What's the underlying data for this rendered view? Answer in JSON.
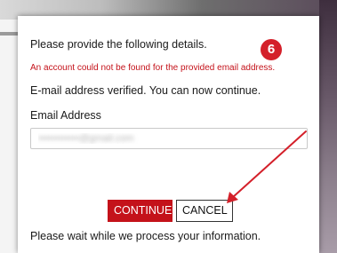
{
  "dialog": {
    "prompt": "Please provide the following details.",
    "error_message": "An account could not be found for the provided email address.",
    "verified_message": "E-mail address verified. You can now continue.",
    "email_label": "Email Address",
    "email_value": "••••••••••••@gmail.com",
    "continue_label": "CONTINUE",
    "cancel_label": "CANCEL",
    "wait_message": "Please wait while we process your information."
  },
  "annotation": {
    "step_badge": "6",
    "accent_color": "#d4202a"
  }
}
